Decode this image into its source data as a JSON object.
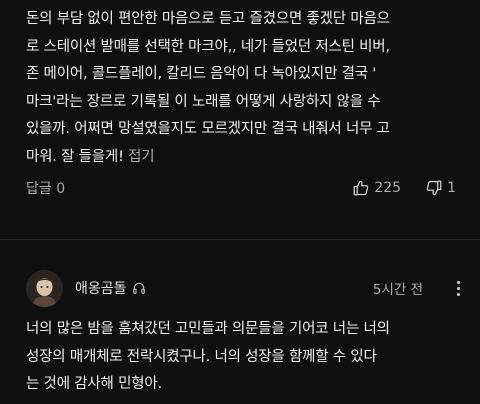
{
  "comment1": {
    "lines": [
      "돈의 부담 없이 편안한 마음으로 듣고 즐겼으면 좋겠단 마음으",
      "로 스테이션 발매를 선택한 마크야,, 네가 들었던 저스틴 비버,",
      " 존 메이어, 콜드플레이, 칼리드 음악이 다 녹아있지만 결국 '",
      "마크'라는 장르로 기록될 이 노래를 어떻게 사랑하지 않을 수",
      "있을까. 어쩌면 망설였을지도 모르겠지만 결국 내줘서 너무 고",
      "마워. 잘 들을게!"
    ],
    "collapse_label": "접기",
    "reply_label": "답글 0",
    "like_count": "225",
    "dislike_count": "1"
  },
  "comment2": {
    "author": "애옹곰돌",
    "timestamp": "5시간 전",
    "lines": [
      "너의 많은 밤을 훔쳐갔던 고민들과 의문들을 기어코 너는 너의",
      " 성장의 매개체로 전락시켰구나. 너의 성장을 함께할 수 있다",
      "는 것에 감사해 민형아."
    ]
  },
  "icons": {
    "like": "thumbs-up-icon",
    "dislike": "thumbs-down-icon",
    "headphone": "headphone-icon",
    "more": "more-vert-icon"
  },
  "colors": {
    "background": "#0f0f0f",
    "text": "#f1f1f1",
    "secondary": "#aaaaaa"
  }
}
